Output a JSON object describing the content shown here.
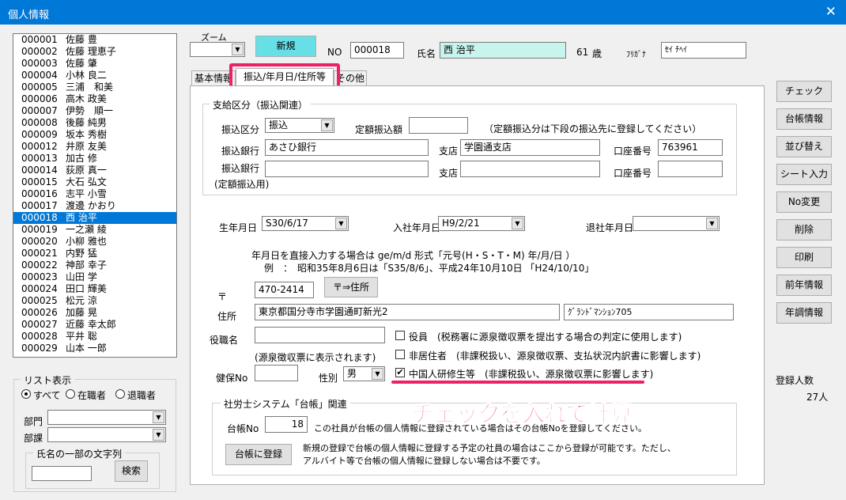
{
  "window": {
    "title": "個人情報",
    "close": "✕"
  },
  "list": [
    {
      "code": "000001",
      "name": "佐藤 豊"
    },
    {
      "code": "000002",
      "name": "佐藤 理恵子"
    },
    {
      "code": "000003",
      "name": "佐藤 肇"
    },
    {
      "code": "000004",
      "name": "小林 良二"
    },
    {
      "code": "000005",
      "name": "三浦　和美"
    },
    {
      "code": "000006",
      "name": "高木 政美"
    },
    {
      "code": "000007",
      "name": "伊勢　順一"
    },
    {
      "code": "000008",
      "name": "後藤 純男"
    },
    {
      "code": "000009",
      "name": "坂本 秀樹"
    },
    {
      "code": "000012",
      "name": "井原 友美"
    },
    {
      "code": "000013",
      "name": "加古 修"
    },
    {
      "code": "000014",
      "name": "荻原 真一"
    },
    {
      "code": "000015",
      "name": "大石 弘文"
    },
    {
      "code": "000016",
      "name": "志平 小雪"
    },
    {
      "code": "000017",
      "name": "渡邊 かおり"
    },
    {
      "code": "000018",
      "name": "西 治平"
    },
    {
      "code": "000019",
      "name": "一之瀬 綾"
    },
    {
      "code": "000020",
      "name": "小柳 雅也"
    },
    {
      "code": "000021",
      "name": "内野 猛"
    },
    {
      "code": "000022",
      "name": "神部 幸子"
    },
    {
      "code": "000023",
      "name": "山田 学"
    },
    {
      "code": "000024",
      "name": "田口 輝美"
    },
    {
      "code": "000025",
      "name": "松元 涼"
    },
    {
      "code": "000026",
      "name": "加藤 晃"
    },
    {
      "code": "000027",
      "name": "近藤 幸太郎"
    },
    {
      "code": "000028",
      "name": "平井 聡"
    },
    {
      "code": "000029",
      "name": "山本 一郎"
    }
  ],
  "list_selected_index": 15,
  "filter": {
    "group_label": "リスト表示",
    "radio_all": "すべて",
    "radio_active": "在職者",
    "radio_retired": "退職者",
    "dept_label": "部門",
    "section_label": "部課",
    "name_search_label": "氏名の一部の文字列",
    "search_button": "検索"
  },
  "header": {
    "zoom_label": "ズーム",
    "new_button": "新規",
    "no_label": "NO",
    "no_value": "000018",
    "name_label": "氏名",
    "name_value": "西 治平",
    "age_value": "61",
    "age_unit": "歳",
    "kana_label": "ﾌﾘｶﾞﾅ",
    "kana_value": "ｾｲ ﾁﾍｲ"
  },
  "tabs": [
    "基本情報",
    "振込/年月日/住所等",
    "その他"
  ],
  "active_tab": 1,
  "payment": {
    "group_label": "支給区分（振込関連）",
    "type_label": "振込区分",
    "type_value": "振込",
    "fixed_amount_label": "定額振込額",
    "fixed_note": "（定額振込分は下段の振込先に登録してください）",
    "bank1_label": "振込銀行",
    "bank1_value": "あさひ銀行",
    "branch_label": "支店",
    "branch1_value": "学園通支店",
    "account_label": "口座番号",
    "account1_value": "763961",
    "bank2_label": "振込銀行",
    "bank2_sub": "(定額振込用)",
    "branch2_value": "",
    "account2_value": ""
  },
  "dates": {
    "birth_label": "生年月日",
    "birth_value": "S30/6/17",
    "join_label": "入社年月日",
    "join_value": "H9/2/21",
    "leave_label": "退社年月日",
    "leave_value": "",
    "note1": "年月日を直接入力する場合は ge/m/d  形式「元号(H・S・T・M)  年/月/日 ）",
    "note2": "例　：　昭和35年8月6日は「S35/8/6」、平成24年10月10日 「H24/10/10」"
  },
  "address": {
    "postal_mark": "〒",
    "postal_value": "470-2414",
    "postal_button": "〒⇒住所",
    "address_label": "住所",
    "address_value": "東京都国分寺市学園通町新光2",
    "building_value": "ｸﾞﾗﾝﾄﾞﾏﾝｼｮﾝ705"
  },
  "misc": {
    "position_label": "役職名",
    "position_value": "",
    "position_note": "(源泉徴収票に表示されます)",
    "officer_label": "役員　(税務署に源泉徴収票を提出する場合の判定に使用します)",
    "nonres_label": "非居住者　(非課税扱い、源泉徴収票、支払状況内訳書に影響します)",
    "trainee_label": "中国人研修生等　(非課税扱い、源泉徴収票に影響します)",
    "trainee_checked": "✔",
    "insurance_label": "健保No",
    "insurance_value": "",
    "gender_label": "性別",
    "gender_value": "男"
  },
  "ledger": {
    "group_label": "社労士システム「台帳」関連",
    "no_label": "台帳No",
    "no_value": "18",
    "no_note": "この社員が台帳の個人情報に登録されている場合はその台帳Noを登録してください。",
    "register_button": "台帳に登録",
    "register_note1": "新規の登録で台帳の個人情報に登録する予定の社員の場合はここから登録が可能です。ただし、",
    "register_note2": "アルバイト等で台帳の個人情報に登録しない場合は不要です。"
  },
  "callout": "チェックを入れて計算",
  "side_buttons": [
    "チェック",
    "台帳情報",
    "並び替え",
    "シート入力",
    "No変更",
    "削除",
    "印刷",
    "前年情報",
    "年調情報"
  ],
  "count": {
    "label": "登録人数",
    "value": "27人"
  },
  "colors": {
    "title_bar": "#0078d7",
    "highlight": "#ee2067",
    "new_button": "#66e0e6",
    "name_field": "#c8f4ee"
  }
}
